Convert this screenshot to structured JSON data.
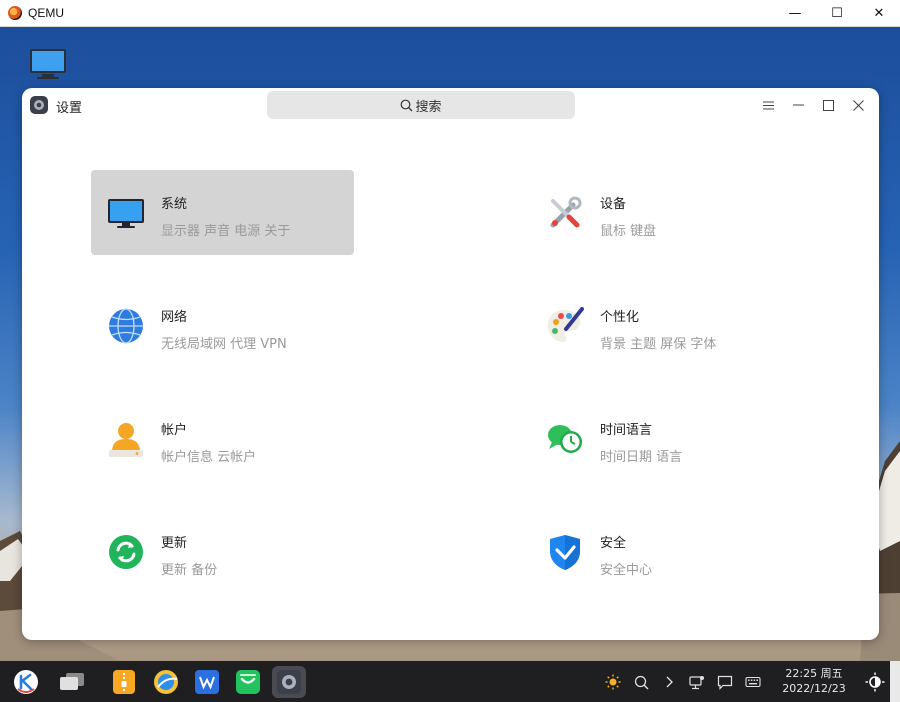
{
  "host": {
    "title": "QEMU",
    "controls": [
      "—",
      "☐",
      "✕"
    ]
  },
  "window": {
    "title": "设置",
    "search": {
      "label": "搜索"
    }
  },
  "categories": [
    {
      "id": "system",
      "title": "系统",
      "subtitle": "显示器 声音 电源 关于",
      "icon": "monitor-icon",
      "selected": true
    },
    {
      "id": "devices",
      "title": "设备",
      "subtitle": "鼠标 键盘",
      "icon": "tools-icon",
      "selected": false
    },
    {
      "id": "network",
      "title": "网络",
      "subtitle": "无线局域网 代理 VPN",
      "icon": "globe-icon",
      "selected": false
    },
    {
      "id": "personalize",
      "title": "个性化",
      "subtitle": "背景 主题 屏保 字体",
      "icon": "palette-icon",
      "selected": false
    },
    {
      "id": "account",
      "title": "帐户",
      "subtitle": "帐户信息 云帐户",
      "icon": "user-icon",
      "selected": false
    },
    {
      "id": "time-language",
      "title": "时间语言",
      "subtitle": "时间日期 语言",
      "icon": "clock-chat-icon",
      "selected": false
    },
    {
      "id": "update",
      "title": "更新",
      "subtitle": "更新 备份",
      "icon": "refresh-icon",
      "selected": false
    },
    {
      "id": "security",
      "title": "安全",
      "subtitle": "安全中心",
      "icon": "shield-icon",
      "selected": false
    }
  ],
  "taskbar": {
    "time": "22:25 周五",
    "date": "2022/12/23"
  }
}
